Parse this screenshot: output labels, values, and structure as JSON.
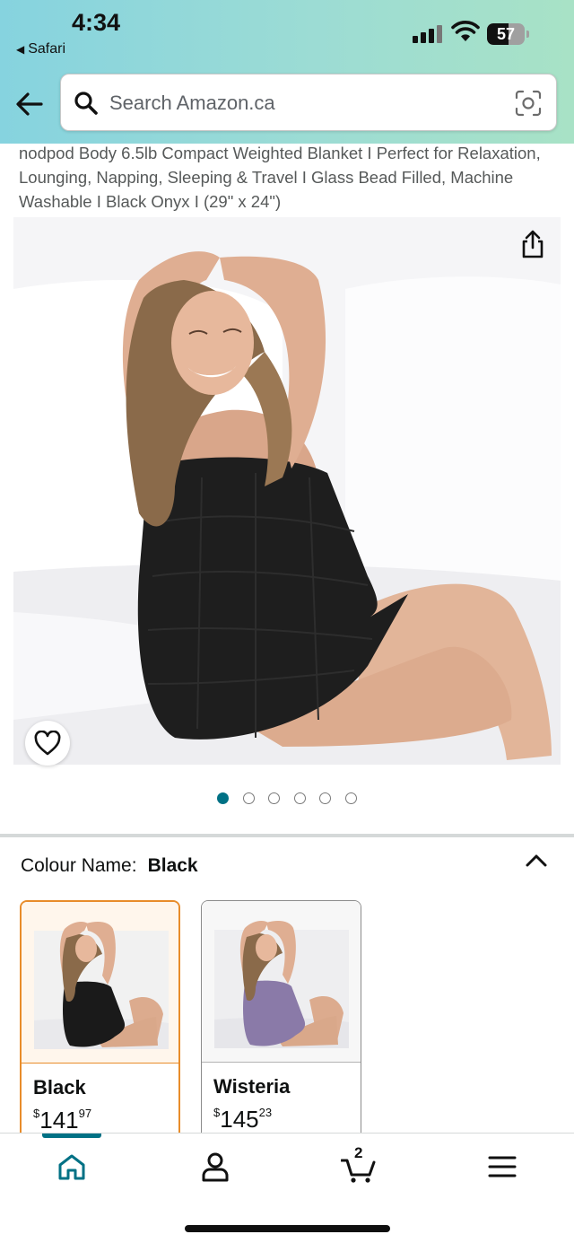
{
  "status_bar": {
    "time": "4:34",
    "back_app": "Safari",
    "battery": "57",
    "battery_level": 0.57
  },
  "header": {
    "search_placeholder": "Search Amazon.ca"
  },
  "product": {
    "title": "nodpod Body 6.5lb Compact Weighted Blanket I Perfect for Relaxation, Lounging, Napping, Sleeping & Travel I Glass Bead Filled, Machine Washable I Black Onyx I (29\" x 24\")",
    "image_count": 6,
    "active_image_index": 0
  },
  "colour": {
    "label": "Colour Name:",
    "selected": "Black",
    "options": [
      {
        "name": "Black",
        "currency": "$",
        "price_whole": "141",
        "price_fraction": "97",
        "swatch_color": "#1c1c1c"
      },
      {
        "name": "Wisteria",
        "currency": "$",
        "price_whole": "145",
        "price_fraction": "23",
        "swatch_color": "#8a7aa8"
      }
    ]
  },
  "bottom_nav": {
    "items": [
      "home-icon",
      "account-icon",
      "cart-icon",
      "menu-icon"
    ],
    "cart_count": "2",
    "accent_color": "#007185"
  }
}
